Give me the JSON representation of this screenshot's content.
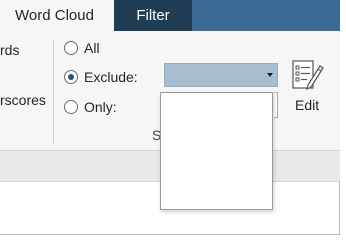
{
  "tabs": {
    "word_cloud": "Word Cloud",
    "filter": "Filter"
  },
  "left_group": {
    "fragment_1": "rds",
    "fragment_2": "rscores"
  },
  "filter_group": {
    "options": [
      {
        "label": "All",
        "selected": false
      },
      {
        "label": "Exclude:",
        "selected": true
      },
      {
        "label": "Only:",
        "selected": false
      }
    ],
    "exclude_value": "",
    "group_label_fragment": "S"
  },
  "edit": {
    "label": "Edit",
    "icon": "edit-list-icon"
  },
  "colors": {
    "tab_strip": "#3c6b96",
    "active_tab": "#203d56",
    "combo_background": "#a9bdd1",
    "ribbon": "#f6f6f6"
  }
}
